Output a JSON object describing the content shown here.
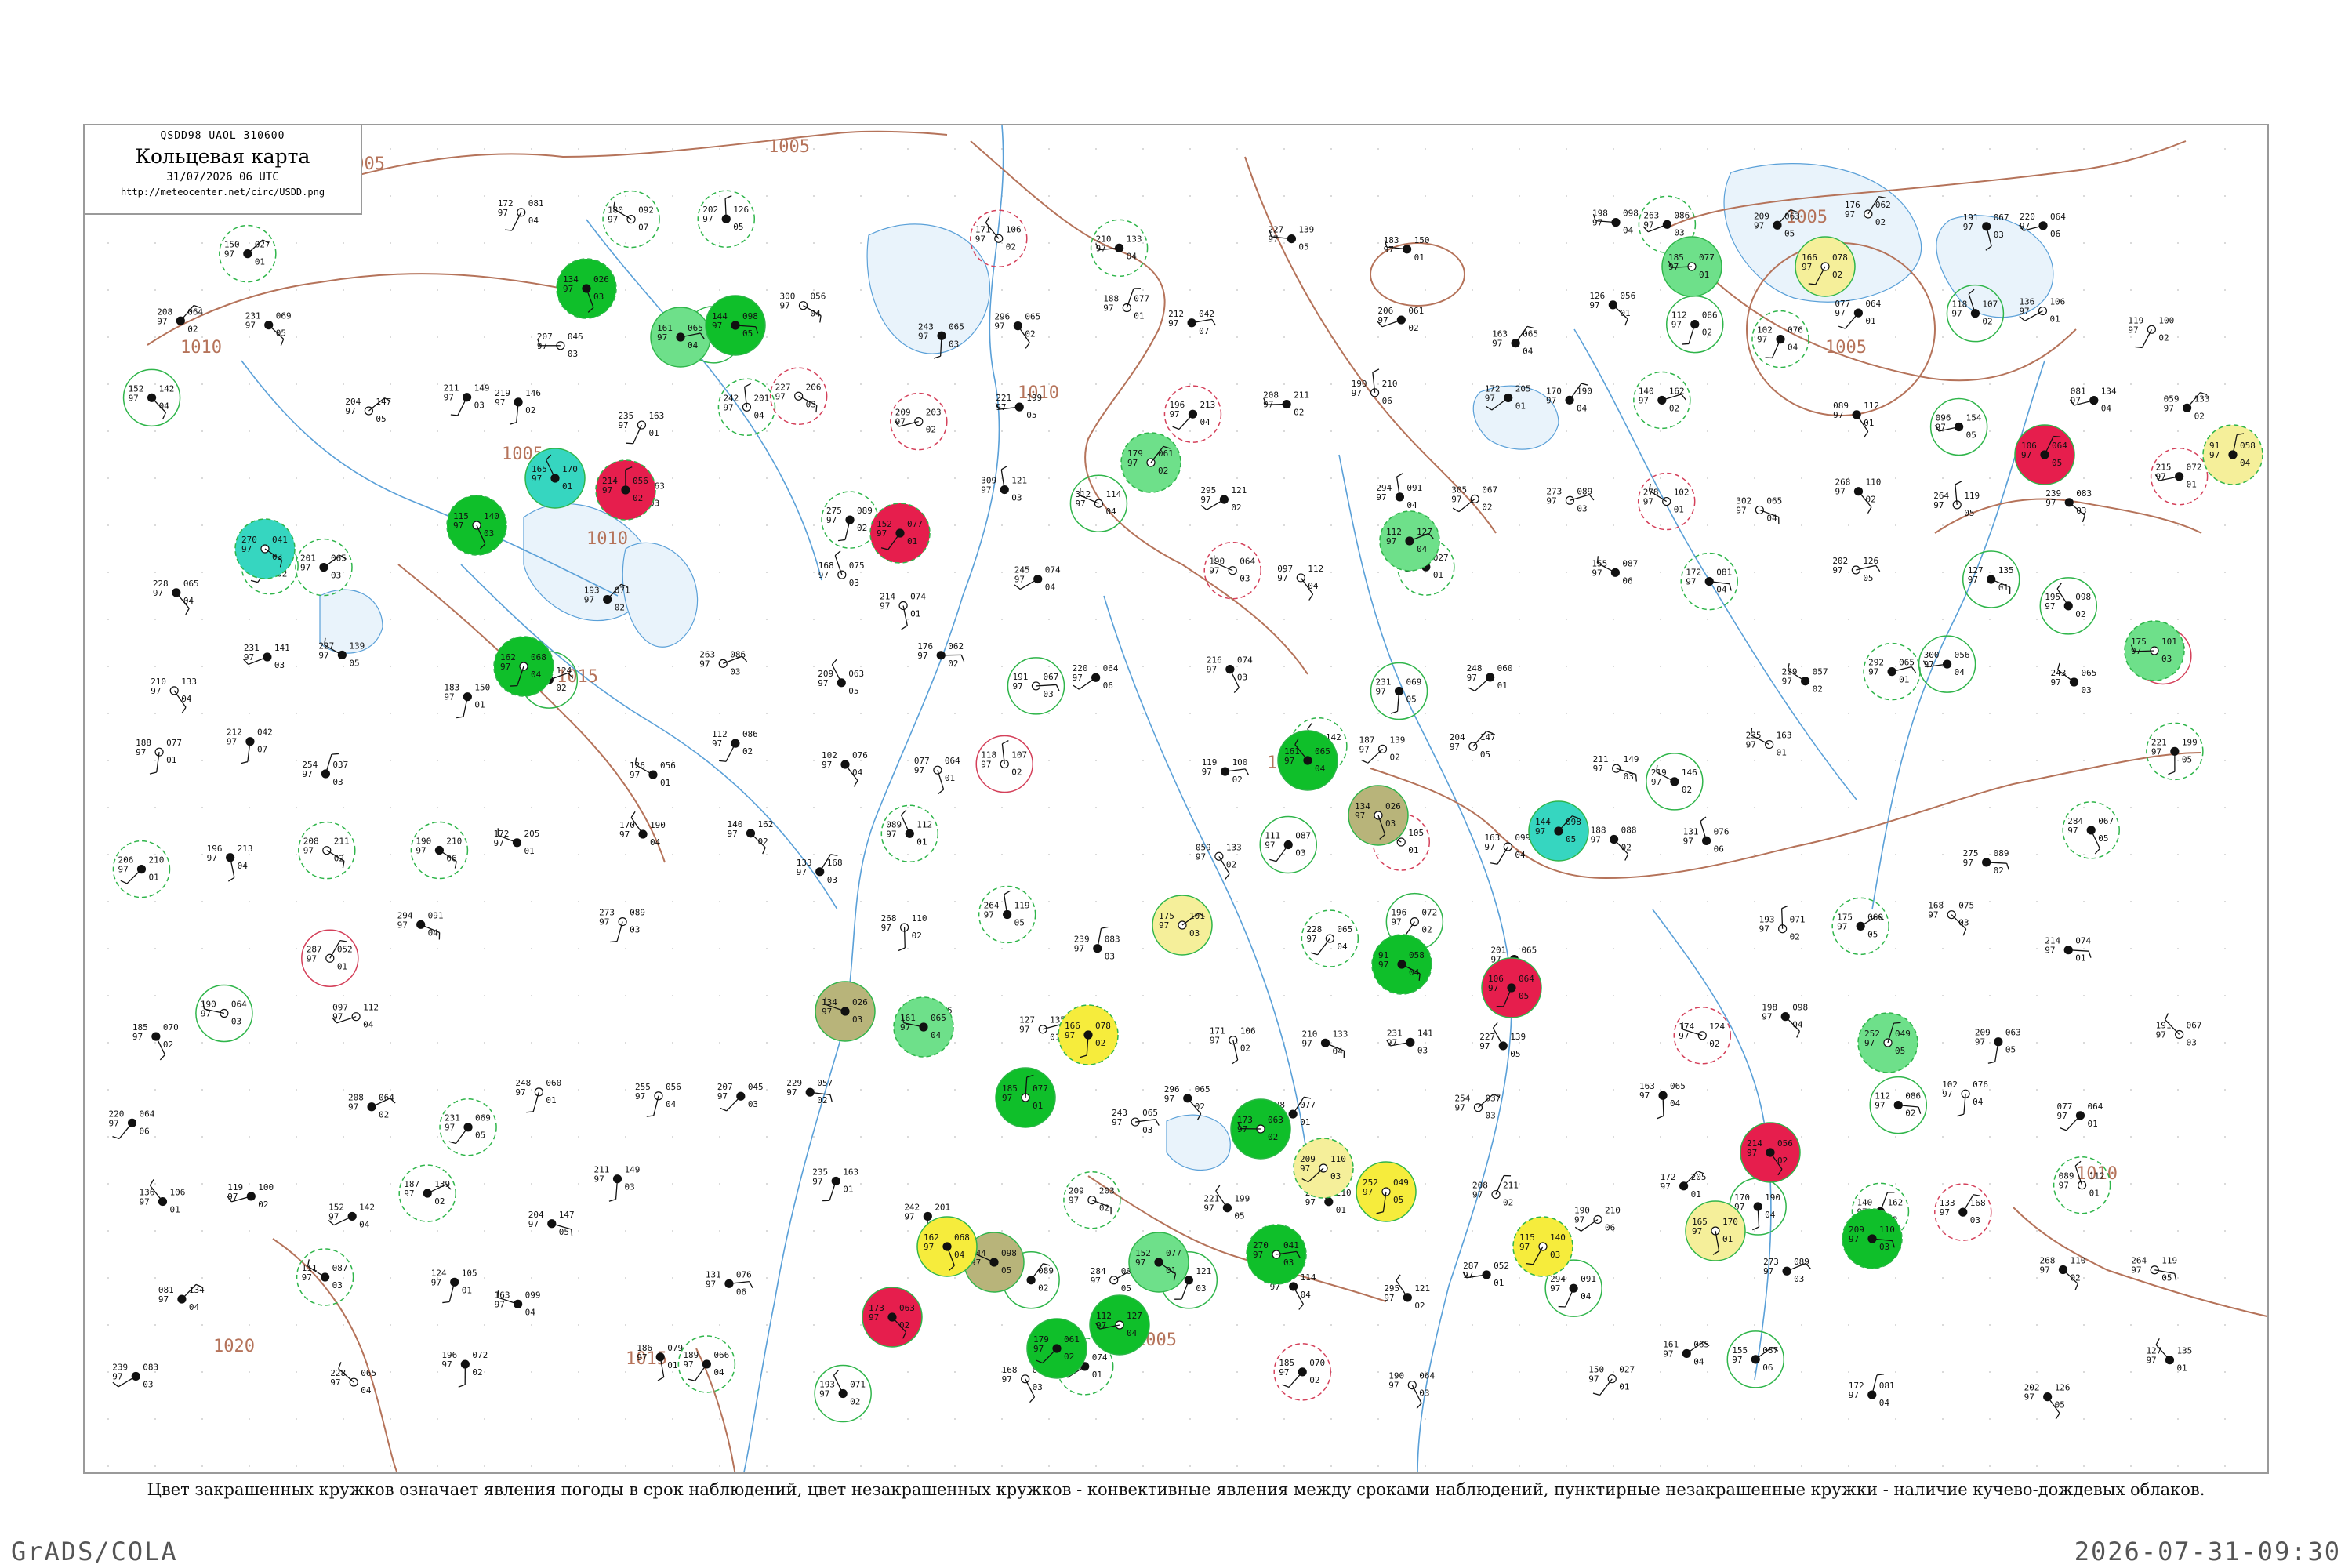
{
  "title_box": {
    "code": "QSDD98  UAOL  310600",
    "title": "Кольцевая карта",
    "datetime": "31/07/2026 06 UTC",
    "url": "http://meteocenter.net/circ/USDD.png"
  },
  "isobars": [
    {
      "label": "1005"
    },
    {
      "label": "1005"
    },
    {
      "label": "1005"
    },
    {
      "label": "1005"
    },
    {
      "label": "1010"
    },
    {
      "label": "1010"
    },
    {
      "label": "1010"
    },
    {
      "label": "1015"
    },
    {
      "label": "1020"
    },
    {
      "label": "1005"
    },
    {
      "label": "1005"
    },
    {
      "label": "1010"
    },
    {
      "label": "1015"
    },
    {
      "label": "1010"
    }
  ],
  "colors": {
    "isobar": "#b5735a",
    "river": "#5aa0d8",
    "lake_fill": "#e9f3fb",
    "green_filled": "#0fbf2a",
    "red_filled": "#e61e4d",
    "yellow_filled": "#f6ec3c",
    "pale_yellow": "#f5ef9a",
    "cyan_filled": "#36d6c0",
    "light_green": "#6ee08a",
    "olive": "#b8b47a",
    "outline_green": "#2fb54a",
    "outline_red": "#d4405a"
  },
  "stations": [
    {
      "t": "097",
      "p": "112",
      "d": "04"
    },
    {
      "t": "150",
      "p": "027",
      "d": "01"
    },
    {
      "t": "161",
      "p": "065",
      "d": "04"
    },
    {
      "t": "155",
      "p": "087",
      "d": "06"
    },
    {
      "t": "172",
      "p": "081",
      "d": "04"
    },
    {
      "t": "180",
      "p": "092",
      "d": "07"
    },
    {
      "t": "202",
      "p": "126",
      "d": "05"
    },
    {
      "t": "127",
      "p": "135",
      "d": "01"
    },
    {
      "t": "195",
      "p": "098",
      "d": "02"
    },
    {
      "t": "171",
      "p": "106",
      "d": "02"
    },
    {
      "t": "210",
      "p": "133",
      "d": "04"
    },
    {
      "t": "231",
      "p": "141",
      "d": "03"
    },
    {
      "t": "227",
      "p": "139",
      "d": "05"
    },
    {
      "t": "183",
      "p": "150",
      "d": "01"
    },
    {
      "t": "174",
      "p": "124",
      "d": "02"
    },
    {
      "t": "198",
      "p": "098",
      "d": "04"
    },
    {
      "t": "263",
      "p": "086",
      "d": "03"
    },
    {
      "t": "209",
      "p": "063",
      "d": "05"
    },
    {
      "t": "176",
      "p": "062",
      "d": "02"
    },
    {
      "t": "191",
      "p": "067",
      "d": "03"
    },
    {
      "t": "220",
      "p": "064",
      "d": "06"
    },
    {
      "t": "216",
      "p": "074",
      "d": "03"
    },
    {
      "t": "208",
      "p": "064",
      "d": "02"
    },
    {
      "t": "231",
      "p": "069",
      "d": "05"
    },
    {
      "t": "248",
      "p": "060",
      "d": "01"
    },
    {
      "t": "255",
      "p": "056",
      "d": "04"
    },
    {
      "t": "207",
      "p": "045",
      "d": "03"
    },
    {
      "t": "229",
      "p": "057",
      "d": "02"
    },
    {
      "t": "292",
      "p": "065",
      "d": "01"
    },
    {
      "t": "300",
      "p": "056",
      "d": "04"
    },
    {
      "t": "243",
      "p": "065",
      "d": "03"
    },
    {
      "t": "296",
      "p": "065",
      "d": "02"
    },
    {
      "t": "188",
      "p": "077",
      "d": "01"
    },
    {
      "t": "212",
      "p": "042",
      "d": "07"
    },
    {
      "t": "254",
      "p": "037",
      "d": "03"
    },
    {
      "t": "206",
      "p": "061",
      "d": "02"
    },
    {
      "t": "163",
      "p": "065",
      "d": "04"
    },
    {
      "t": "126",
      "p": "056",
      "d": "01"
    },
    {
      "t": "112",
      "p": "086",
      "d": "02"
    },
    {
      "t": "102",
      "p": "076",
      "d": "04"
    },
    {
      "t": "077",
      "p": "064",
      "d": "01"
    },
    {
      "t": "118",
      "p": "107",
      "d": "02"
    },
    {
      "t": "136",
      "p": "106",
      "d": "01"
    },
    {
      "t": "119",
      "p": "100",
      "d": "02"
    },
    {
      "t": "152",
      "p": "142",
      "d": "04"
    },
    {
      "t": "187",
      "p": "139",
      "d": "02"
    },
    {
      "t": "204",
      "p": "147",
      "d": "05"
    },
    {
      "t": "211",
      "p": "149",
      "d": "03"
    },
    {
      "t": "219",
      "p": "146",
      "d": "02"
    },
    {
      "t": "235",
      "p": "163",
      "d": "01"
    },
    {
      "t": "242",
      "p": "201",
      "d": "04"
    },
    {
      "t": "227",
      "p": "206",
      "d": "03"
    },
    {
      "t": "209",
      "p": "203",
      "d": "02"
    },
    {
      "t": "221",
      "p": "199",
      "d": "05"
    },
    {
      "t": "206",
      "p": "210",
      "d": "01"
    },
    {
      "t": "196",
      "p": "213",
      "d": "04"
    },
    {
      "t": "208",
      "p": "211",
      "d": "02"
    },
    {
      "t": "190",
      "p": "210",
      "d": "06"
    },
    {
      "t": "172",
      "p": "205",
      "d": "01"
    },
    {
      "t": "170",
      "p": "190",
      "d": "04"
    },
    {
      "t": "140",
      "p": "162",
      "d": "02"
    },
    {
      "t": "133",
      "p": "168",
      "d": "03"
    },
    {
      "t": "089",
      "p": "112",
      "d": "01"
    },
    {
      "t": "096",
      "p": "154",
      "d": "05"
    },
    {
      "t": "081",
      "p": "134",
      "d": "04"
    },
    {
      "t": "059",
      "p": "133",
      "d": "02"
    },
    {
      "t": "111",
      "p": "087",
      "d": "03"
    },
    {
      "t": "124",
      "p": "105",
      "d": "01"
    },
    {
      "t": "163",
      "p": "099",
      "d": "04"
    },
    {
      "t": "188",
      "p": "088",
      "d": "02"
    },
    {
      "t": "131",
      "p": "076",
      "d": "06"
    },
    {
      "t": "178",
      "p": "063",
      "d": "03"
    },
    {
      "t": "250",
      "p": "060",
      "d": "01"
    },
    {
      "t": "275",
      "p": "089",
      "d": "02"
    },
    {
      "t": "284",
      "p": "067",
      "d": "05"
    },
    {
      "t": "309",
      "p": "121",
      "d": "03"
    },
    {
      "t": "312",
      "p": "114",
      "d": "04"
    },
    {
      "t": "295",
      "p": "121",
      "d": "02"
    },
    {
      "t": "287",
      "p": "052",
      "d": "01"
    },
    {
      "t": "294",
      "p": "091",
      "d": "04"
    },
    {
      "t": "305",
      "p": "067",
      "d": "02"
    },
    {
      "t": "273",
      "p": "089",
      "d": "03"
    },
    {
      "t": "278",
      "p": "102",
      "d": "01"
    },
    {
      "t": "302",
      "p": "065",
      "d": "04"
    },
    {
      "t": "268",
      "p": "110",
      "d": "02"
    },
    {
      "t": "264",
      "p": "119",
      "d": "05"
    },
    {
      "t": "239",
      "p": "083",
      "d": "03"
    },
    {
      "t": "215",
      "p": "072",
      "d": "01"
    },
    {
      "t": "228",
      "p": "065",
      "d": "04"
    },
    {
      "t": "196",
      "p": "072",
      "d": "02"
    },
    {
      "t": "201",
      "p": "065",
      "d": "03"
    },
    {
      "t": "186",
      "p": "079",
      "d": "01"
    },
    {
      "t": "189",
      "p": "066",
      "d": "04"
    },
    {
      "t": "193",
      "p": "071",
      "d": "02"
    },
    {
      "t": "175",
      "p": "060",
      "d": "05"
    },
    {
      "t": "168",
      "p": "075",
      "d": "03"
    },
    {
      "t": "214",
      "p": "074",
      "d": "01"
    },
    {
      "t": "245",
      "p": "074",
      "d": "04"
    },
    {
      "t": "185",
      "p": "070",
      "d": "02"
    },
    {
      "t": "190",
      "p": "064",
      "d": "03"
    }
  ],
  "stations_filled": [
    {
      "t": "134",
      "p": "026",
      "d": "03"
    },
    {
      "t": "161",
      "p": "065",
      "d": "04"
    },
    {
      "t": "144",
      "p": "098",
      "d": "05"
    },
    {
      "t": "152",
      "p": "077",
      "d": "01"
    },
    {
      "t": "179",
      "p": "061",
      "d": "02"
    },
    {
      "t": "112",
      "p": "127",
      "d": "04"
    },
    {
      "t": "115",
      "p": "140",
      "d": "03"
    },
    {
      "t": "165",
      "p": "170",
      "d": "01"
    },
    {
      "t": "214",
      "p": "056",
      "d": "02"
    },
    {
      "t": "270",
      "p": "041",
      "d": "03"
    },
    {
      "t": "106",
      "p": "064",
      "d": "05"
    },
    {
      "t": "91",
      "p": "058",
      "d": "04"
    },
    {
      "t": "175",
      "p": "101",
      "d": "03"
    },
    {
      "t": "166",
      "p": "078",
      "d": "02"
    },
    {
      "t": "185",
      "p": "077",
      "d": "01"
    },
    {
      "t": "162",
      "p": "068",
      "d": "04"
    },
    {
      "t": "173",
      "p": "063",
      "d": "02"
    },
    {
      "t": "209",
      "p": "110",
      "d": "03"
    },
    {
      "t": "252",
      "p": "049",
      "d": "05"
    }
  ],
  "footer_note": "Цвет закрашенных кружков означает явления погоды в срок наблюдений, цвет незакрашенных кружков - конвективные явления между сроками наблюдений, пунктирные незакрашенные кружки - наличие кучево-дождевых облаков.",
  "software_label": "GrADS/COLA",
  "timestamp_label": "2026-07-31-09:30"
}
